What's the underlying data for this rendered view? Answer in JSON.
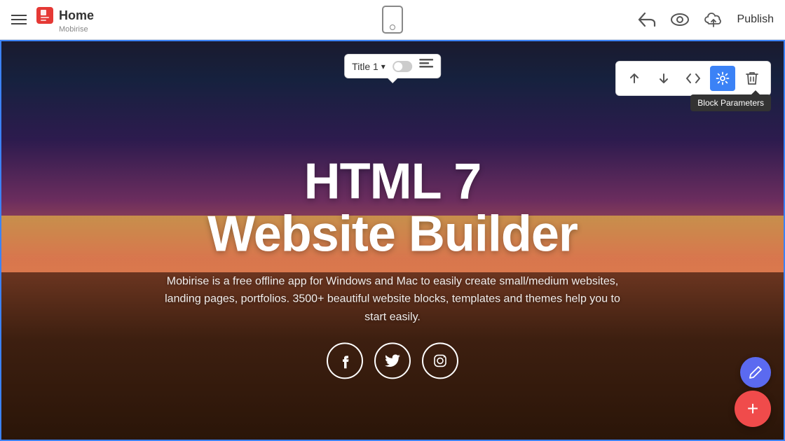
{
  "topbar": {
    "app_name": "Home",
    "app_subname": "Mobirise",
    "publish_label": "Publish"
  },
  "title_popover": {
    "label": "Title 1",
    "chevron": "▾"
  },
  "hero": {
    "title_line1": "HTML 7",
    "title_line2": "Website Builder",
    "description": "Mobirise is a free offline app for Windows and Mac to easily create small/medium websites, landing pages, portfolios. 3500+ beautiful website blocks, templates and themes help you to start easily."
  },
  "block_toolbar": {
    "up_label": "↑",
    "down_label": "↓",
    "code_label": "</>",
    "settings_label": "⚙",
    "delete_label": "🗑"
  },
  "tooltip": {
    "text": "Block Parameters"
  },
  "social": {
    "facebook": "f",
    "twitter": "t",
    "instagram": "ig"
  },
  "fab": {
    "edit": "✏",
    "add": "+"
  }
}
